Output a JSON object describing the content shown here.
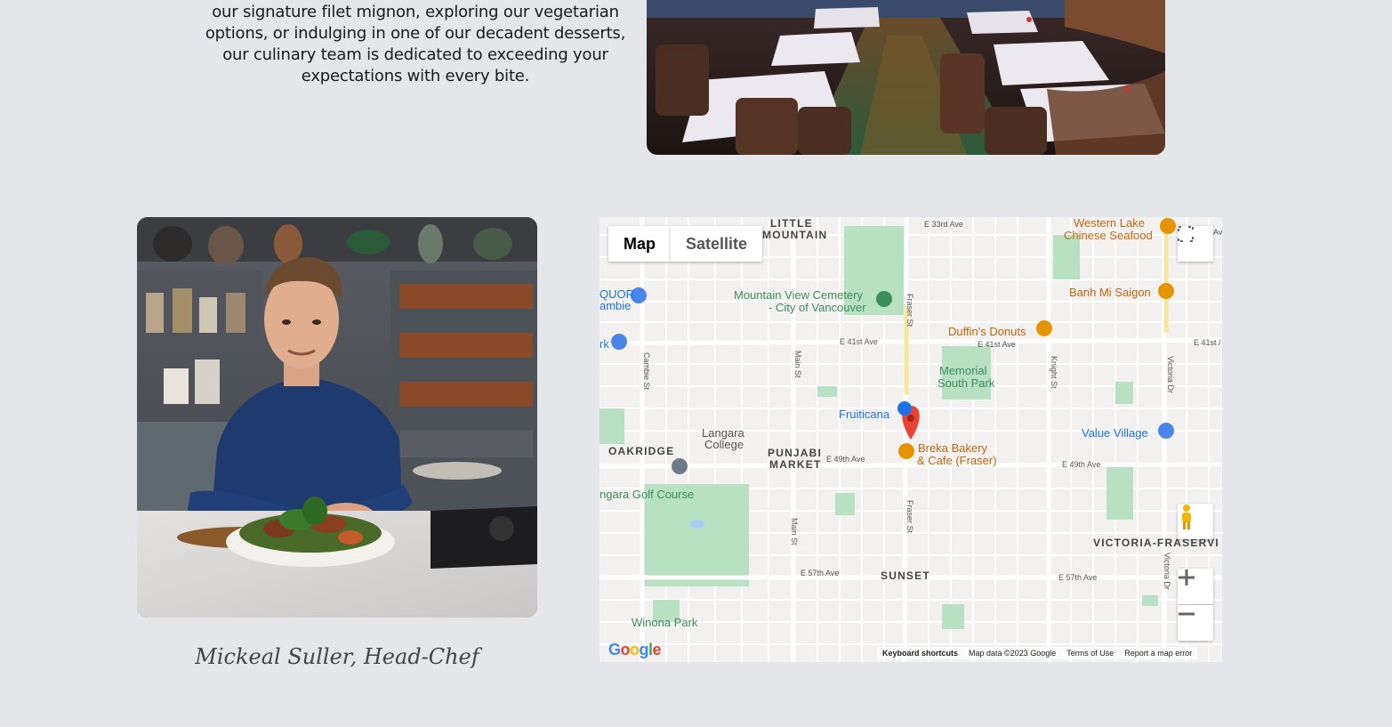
{
  "intro": {
    "text": "our signature filet mignon, exploring our vegetarian options, or indulging in one of our decadent desserts, our culinary team is dedicated to exceeding your expectations with every bite."
  },
  "chef": {
    "caption": "Mickeal Suller, Head-Chef"
  },
  "map": {
    "type_controls": {
      "map_label": "Map",
      "satellite_label": "Satellite"
    },
    "footer": {
      "keyboard": "Keyboard shortcuts",
      "data": "Map data ©2023 Google",
      "terms": "Terms of Use",
      "report": "Report a map error"
    },
    "logo_text": "Google",
    "labels": {
      "little_mountain": "LITTLE",
      "little_mountain2": "MOUNTAIN",
      "western_lake": "Western Lake",
      "western_lake2": "Chinese Seafood",
      "quor": "QUOR",
      "quor2": "ambie",
      "cemetery": "Mountain View Cemetery",
      "cemetery2": "- City of Vancouver",
      "banh_mi": "Banh Mi Saigon",
      "duffins": "Duffin's Donuts",
      "memorial": "Memorial",
      "memorial2": "South Park",
      "fruiticana": "Fruiticana",
      "langara": "Langara",
      "langara2": "College",
      "oakridge": "OAKRIDGE",
      "punjabi": "PUNJABI",
      "punjabi2": "MARKET",
      "breka": "Breka Bakery",
      "breka2": "& Cafe (Fraser)",
      "value_village": "Value Village",
      "golf": "ngara Golf Course",
      "victoria_fraserview": "VICTORIA-FRASERVI",
      "sunset": "SUNSET",
      "winona": "Winona Park",
      "rk": "rk",
      "e33": "E 33rd Ave",
      "e41a": "E 41st Ave",
      "e41b": "E 41st Ave",
      "e41c": "E 41st /",
      "e49a": "E 49th Ave",
      "e49b": "E 49th Ave",
      "e57a": "E 57th Ave",
      "e57b": "E 57th Ave",
      "cambie": "Cambie St",
      "main1": "Main St",
      "main2": "Main St",
      "fraser1": "Fraser St",
      "fraser2": "Fraser St",
      "knight": "Knight St",
      "victoria1": "Victoria Dr",
      "victoria2": "Victoria Dr",
      "av": "Av"
    }
  }
}
